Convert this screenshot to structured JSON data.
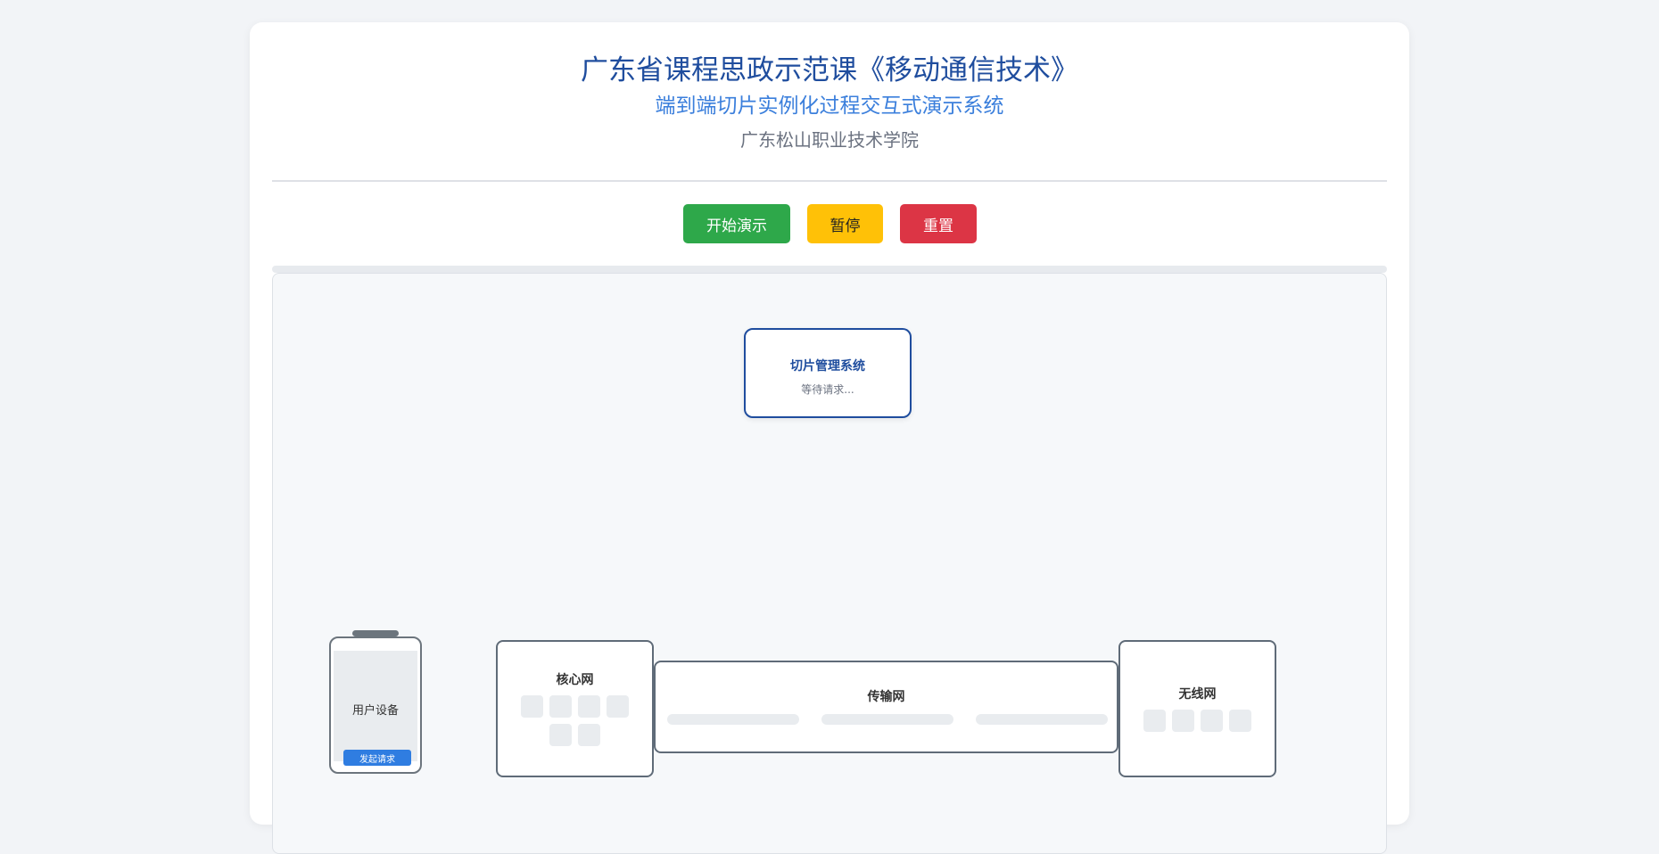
{
  "header": {
    "title": "广东省课程思政示范课《移动通信技术》",
    "subtitle": "端到端切片实例化过程交互式演示系统",
    "school": "广东松山职业技术学院"
  },
  "controls": {
    "start_label": "开始演示",
    "pause_label": "暂停",
    "reset_label": "重置"
  },
  "progress": {
    "value": 0
  },
  "slice_manager": {
    "name": "切片管理系统",
    "status": "等待请求..."
  },
  "user_device": {
    "label": "用户设备",
    "request_button": "发起请求"
  },
  "core_network": {
    "name": "核心网"
  },
  "transport_network": {
    "name": "传输网"
  },
  "radio_network": {
    "name": "无线网"
  },
  "colors": {
    "primary": "#1f4d9e",
    "accent": "#3b7fdc",
    "start": "#2ea84a",
    "pause": "#ffc107",
    "reset": "#dc3545"
  }
}
